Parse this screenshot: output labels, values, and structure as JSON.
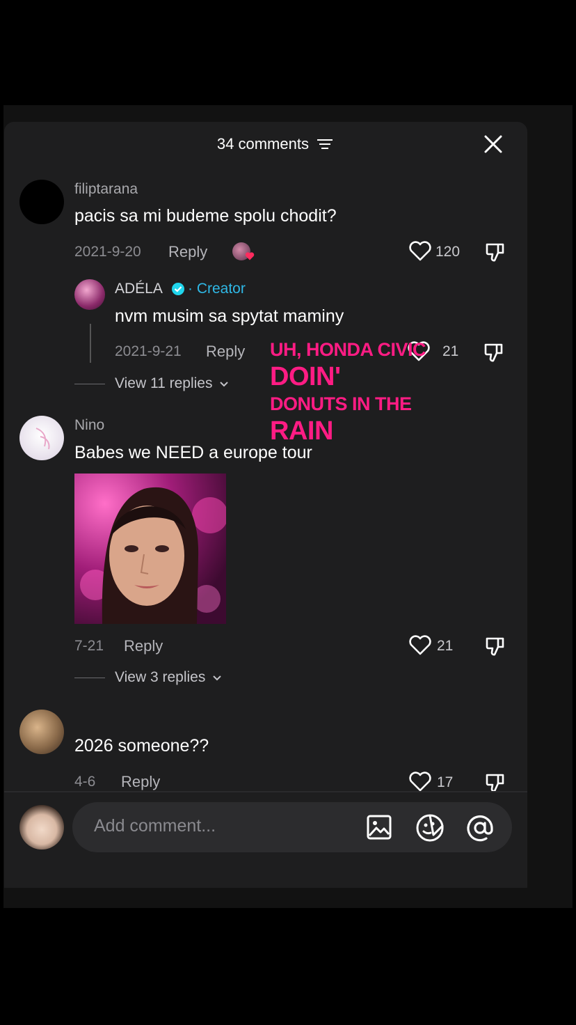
{
  "header": {
    "title": "34 comments"
  },
  "comments": [
    {
      "user": "filiptarana",
      "text": "pacis sa mi budeme spolu chodit?",
      "date": "2021-9-20",
      "reply": "Reply",
      "likes": "120"
    },
    {
      "user": "ADÉLA",
      "badge": "· Creator",
      "text": "nvm musim sa spytat maminy",
      "date": "2021-9-21",
      "reply": "Reply",
      "likes": "21",
      "view_replies": "View 11 replies"
    },
    {
      "user": "Nino",
      "text": "Babes we NEED a europe tour",
      "date": "7-21",
      "reply": "Reply",
      "likes": "21",
      "view_replies": "View 3 replies"
    },
    {
      "user": "",
      "text": "2026 someone??",
      "date": "4-6",
      "reply": "Reply",
      "likes": "17"
    }
  ],
  "overlay_lyrics": [
    "UH, HONDA CIVIC",
    "DOIN'",
    "DONUTS IN THE",
    "RAIN"
  ],
  "input": {
    "placeholder": "Add comment..."
  },
  "colors": {
    "accent_pink": "#ff1c84",
    "creator_blue": "#2fb8e6",
    "verified": "#20d5ec"
  },
  "icons": [
    "filter-icon",
    "close-icon",
    "heart-icon",
    "dislike-icon",
    "image-icon",
    "emoji-icon",
    "mention-icon"
  ]
}
